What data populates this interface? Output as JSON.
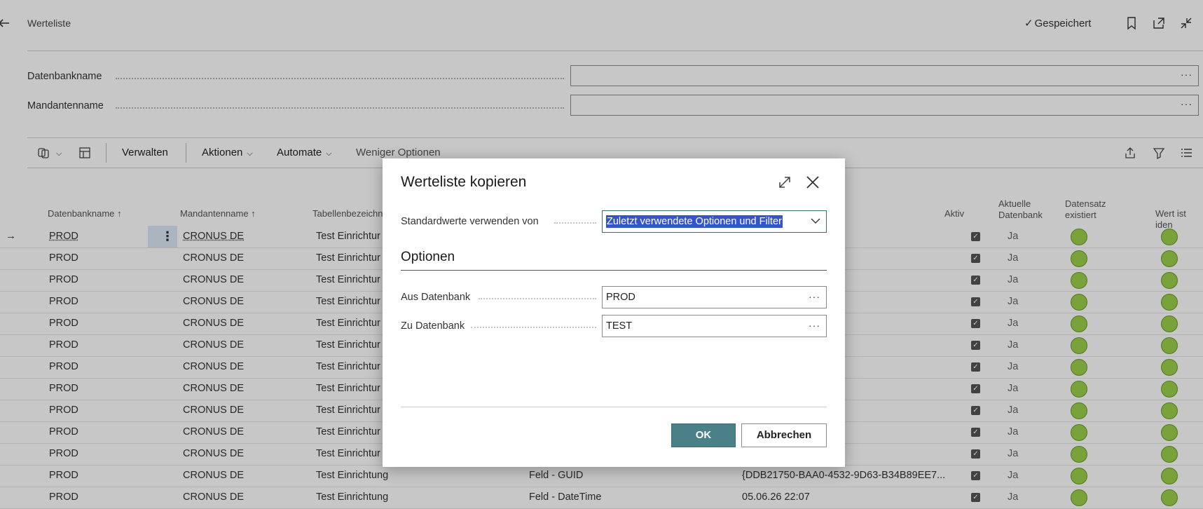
{
  "page": {
    "title": "Werteliste",
    "saved_label": "Gespeichert",
    "fields": [
      {
        "label": "Datenbankname",
        "value": ""
      },
      {
        "label": "Mandantenname",
        "value": ""
      }
    ],
    "toolbar": {
      "manage": "Verwalten",
      "actions": "Aktionen",
      "automate": "Automate",
      "fewer": "Weniger Optionen"
    }
  },
  "table": {
    "headers": {
      "db": "Datenbankname",
      "mandant": "Mandantenname",
      "table": "Tabellenbezeichn",
      "aktiv": "Aktiv",
      "current_db_1": "Aktuelle",
      "current_db_2": "Datenbank",
      "record_1": "Datensatz",
      "record_2": "existiert",
      "same": "Wert ist iden"
    },
    "rows": [
      {
        "db": "PROD",
        "mandant": "CRONUS DE",
        "table": "Test Einrichtur",
        "field": "",
        "value": "",
        "current": "Ja"
      },
      {
        "db": "PROD",
        "mandant": "CRONUS DE",
        "table": "Test Einrichtur",
        "field": "",
        "value": "",
        "current": "Ja"
      },
      {
        "db": "PROD",
        "mandant": "CRONUS DE",
        "table": "Test Einrichtur",
        "field": "",
        "value": "",
        "current": "Ja"
      },
      {
        "db": "PROD",
        "mandant": "CRONUS DE",
        "table": "Test Einrichtur",
        "field": "",
        "value": "",
        "current": "Ja"
      },
      {
        "db": "PROD",
        "mandant": "CRONUS DE",
        "table": "Test Einrichtur",
        "field": "",
        "value": "",
        "current": "Ja"
      },
      {
        "db": "PROD",
        "mandant": "CRONUS DE",
        "table": "Test Einrichtur",
        "field": "",
        "value": "",
        "current": "Ja"
      },
      {
        "db": "PROD",
        "mandant": "CRONUS DE",
        "table": "Test Einrichtur",
        "field": "",
        "value": "",
        "current": "Ja"
      },
      {
        "db": "PROD",
        "mandant": "CRONUS DE",
        "table": "Test Einrichtur",
        "field": "",
        "value": "",
        "current": "Ja"
      },
      {
        "db": "PROD",
        "mandant": "CRONUS DE",
        "table": "Test Einrichtur",
        "field": "",
        "value": "",
        "current": "Ja"
      },
      {
        "db": "PROD",
        "mandant": "CRONUS DE",
        "table": "Test Einrichtur",
        "field": "",
        "value": "",
        "current": "Ja"
      },
      {
        "db": "PROD",
        "mandant": "CRONUS DE",
        "table": "Test Einrichtur",
        "field": "",
        "value": "",
        "current": "Ja"
      },
      {
        "db": "PROD",
        "mandant": "CRONUS DE",
        "table": "Test Einrichtung",
        "field": "Feld - GUID",
        "value": "{DDB21750-BAA0-4532-9D63-B34B89EE7...",
        "current": "Ja"
      },
      {
        "db": "PROD",
        "mandant": "CRONUS DE",
        "table": "Test Einrichtung",
        "field": "Feld - DateTime",
        "value": "05.06.26 22:07",
        "current": "Ja"
      }
    ]
  },
  "dialog": {
    "title": "Werteliste kopieren",
    "defaults_label": "Standardwerte verwenden von",
    "defaults_value": "Zuletzt verwendete Optionen und Filter",
    "section": "Optionen",
    "from_label": "Aus Datenbank",
    "from_value": "PROD",
    "to_label": "Zu Datenbank",
    "to_value": "TEST",
    "ok": "OK",
    "cancel": "Abbrechen"
  },
  "colors": {
    "accent": "#4a8189",
    "selection": "#3355cc",
    "status_green": "#9bd04b"
  }
}
